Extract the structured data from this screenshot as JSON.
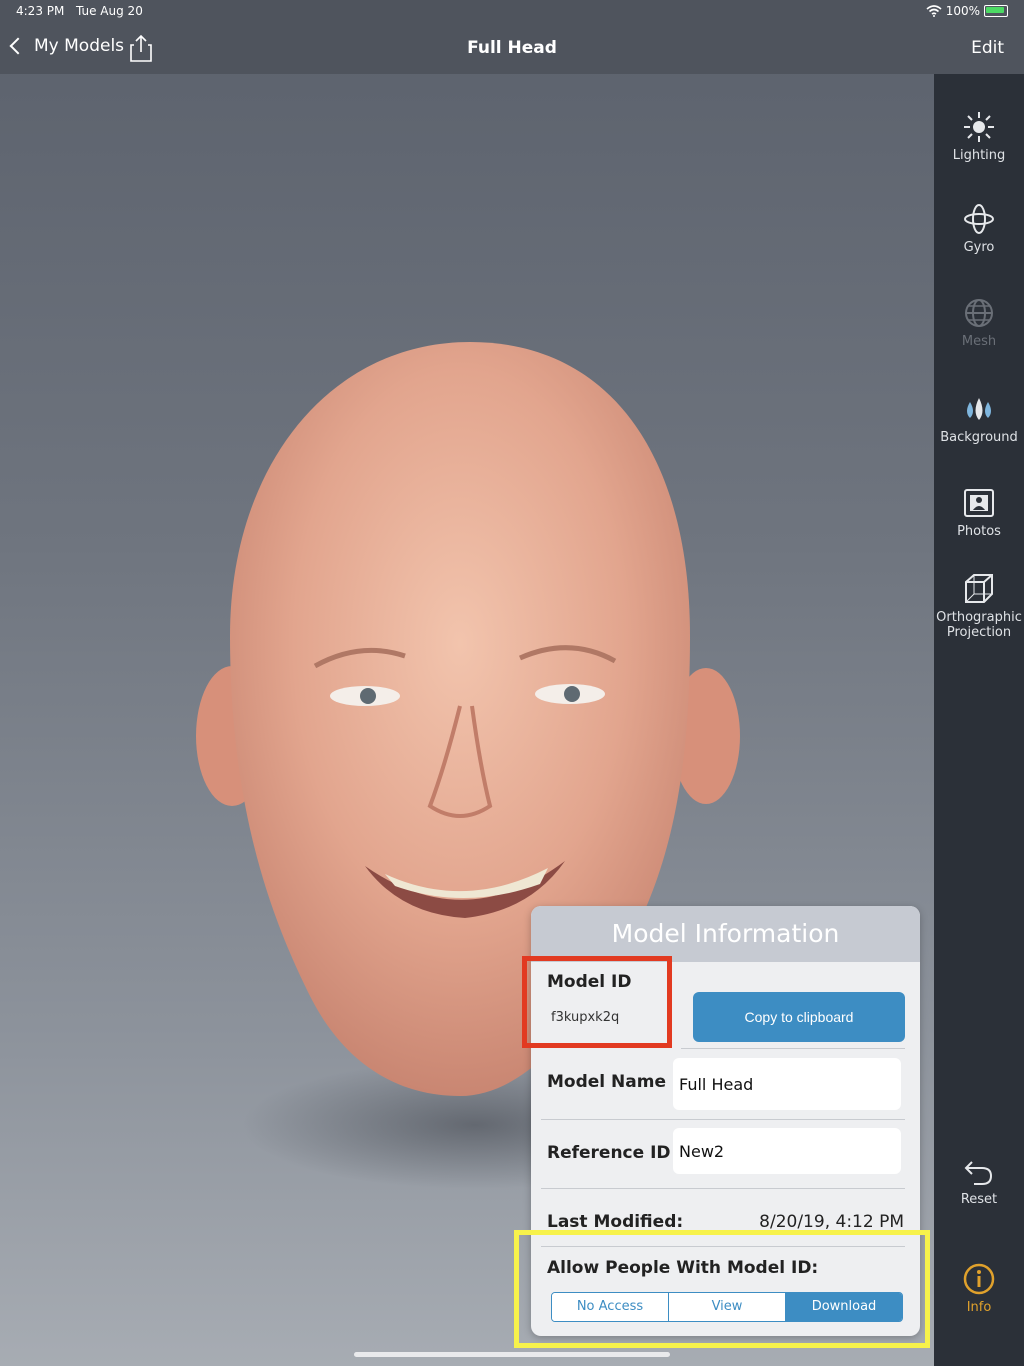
{
  "status_bar": {
    "time": "4:23 PM",
    "date": "Tue Aug 20",
    "battery": "100%"
  },
  "nav": {
    "back_label": "My Models",
    "title": "Full Head",
    "edit_label": "Edit"
  },
  "sidebar": {
    "items": [
      {
        "label": "Lighting",
        "icon": "sun-icon"
      },
      {
        "label": "Gyro",
        "icon": "gyro-icon"
      },
      {
        "label": "Mesh",
        "icon": "globe-mesh-icon"
      },
      {
        "label": "Background",
        "icon": "drops-icon"
      },
      {
        "label": "Photos",
        "icon": "photo-frame-icon"
      },
      {
        "label": "Orthographic",
        "label2": "Projection",
        "icon": "cube-icon"
      },
      {
        "label": "Reset",
        "icon": "undo-icon"
      },
      {
        "label": "Info",
        "icon": "info-icon"
      }
    ]
  },
  "panel": {
    "title": "Model Information",
    "model_id_label": "Model ID",
    "model_id_value": "f3kupxk2q",
    "copy_label": "Copy to clipboard",
    "model_name_label": "Model Name",
    "model_name_value": "Full Head",
    "reference_id_label": "Reference ID",
    "reference_id_value": "New2",
    "last_modified_label": "Last Modified:",
    "last_modified_value": "8/20/19, 4:12 PM",
    "allow_label": "Allow People With Model ID:",
    "access_options": [
      "No Access",
      "View",
      "Download"
    ],
    "selected_access": "Download"
  },
  "colors": {
    "accent": "#3d8dc3",
    "active": "#e0a12c",
    "annotation_red": "#e23a21",
    "annotation_yellow": "#f7f24b"
  }
}
